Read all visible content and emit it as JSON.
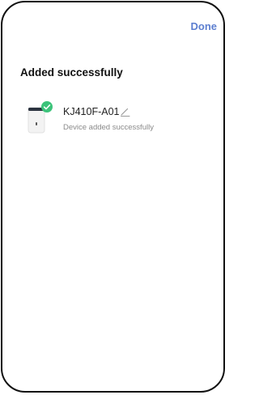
{
  "header": {
    "done_label": "Done"
  },
  "main": {
    "title": "Added successfully",
    "devices": [
      {
        "name": "KJ410F-A01",
        "status": "Device added successfully",
        "icon": "air-purifier-icon",
        "badge_icon": "check-badge-icon",
        "action_icon": "edit-pencil-icon"
      }
    ]
  },
  "colors": {
    "accent": "#5d7fd0",
    "success": "#3cc37a",
    "text_primary": "#111111",
    "text_secondary": "#8a8a8a"
  }
}
